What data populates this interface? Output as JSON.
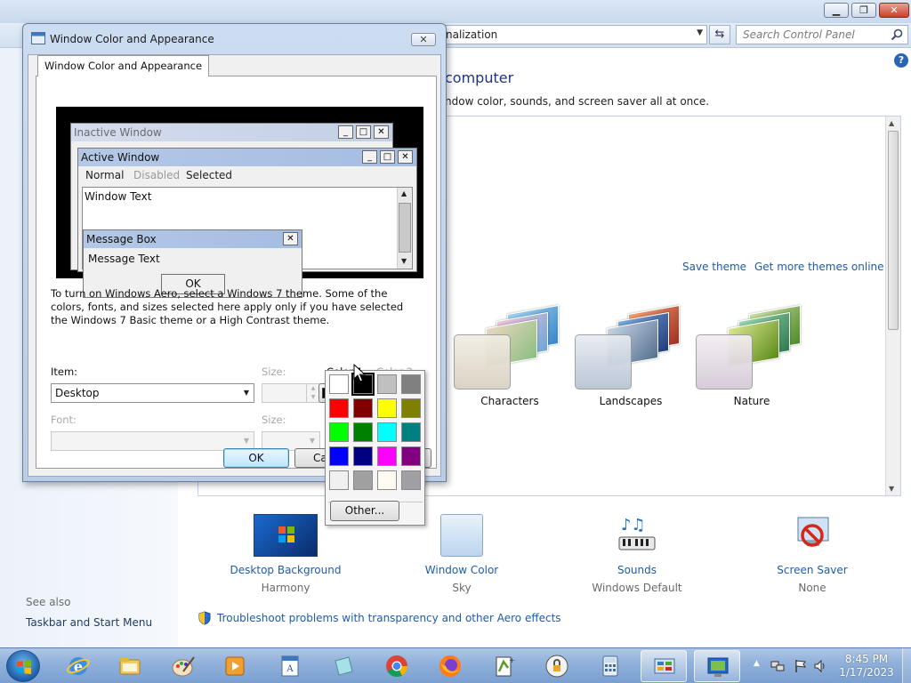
{
  "control_panel": {
    "address": "nalization",
    "search_placeholder": "Search Control Panel",
    "heading": "computer",
    "subtext": "ndow color, sounds, and screen saver all at once.",
    "save_theme": "Save theme",
    "more_themes": "Get more themes online",
    "themes": [
      {
        "label": "Characters"
      },
      {
        "label": "Landscapes"
      },
      {
        "label": "Nature"
      }
    ],
    "bottom_items": [
      {
        "label": "Desktop Background",
        "sub": "Harmony"
      },
      {
        "label": "Window Color",
        "sub": "Sky"
      },
      {
        "label": "Sounds",
        "sub": "Windows Default"
      },
      {
        "label": "Screen Saver",
        "sub": "None"
      }
    ],
    "see_also": "See also",
    "see_also_link": "Taskbar and Start Menu",
    "troubleshoot": "Troubleshoot problems with transparency and other Aero effects"
  },
  "dialog": {
    "title": "Window Color and Appearance",
    "tab": "Window Color and Appearance",
    "preview": {
      "inactive_title": "Inactive Window",
      "active_title": "Active Window",
      "menu_normal": "Normal",
      "menu_disabled": "Disabled",
      "menu_selected": "Selected",
      "window_text": "Window Text",
      "msgbox_title": "Message Box",
      "msgbox_text": "Message Text",
      "msgbox_ok": "OK",
      "btn_min": "_",
      "btn_max": "□",
      "btn_close": "✕"
    },
    "info": "To turn on Windows Aero, select a Windows 7 theme.  Some of the colors, fonts, and sizes selected here apply only if you have selected the Windows 7 Basic theme or a High Contrast theme.",
    "item_label": "Item:",
    "item_value": "Desktop",
    "size_label": "Size:",
    "color1_label": "Color 1:",
    "color2_label": "Color 2:",
    "font_label": "Font:",
    "size2_label": "Size:",
    "ok": "OK",
    "cancel": "Ca",
    "close_glyph": "✕"
  },
  "palette": {
    "colors": [
      "#ffffff",
      "#000000",
      "#c0c0c0",
      "#808080",
      "#ff0000",
      "#800000",
      "#ffff00",
      "#808000",
      "#00ff00",
      "#008000",
      "#00ffff",
      "#008080",
      "#0000ff",
      "#000080",
      "#ff00ff",
      "#800080",
      "#f0f0f0",
      "#a0a0a0",
      "#fffbf0",
      "#a0a0a4"
    ],
    "selected_index": 1,
    "other": "Other..."
  },
  "taskbar": {
    "time": "8:45 PM",
    "date": "1/17/2023"
  },
  "colors": {
    "accent": "#1e5ca8",
    "heading": "#1e3287"
  }
}
